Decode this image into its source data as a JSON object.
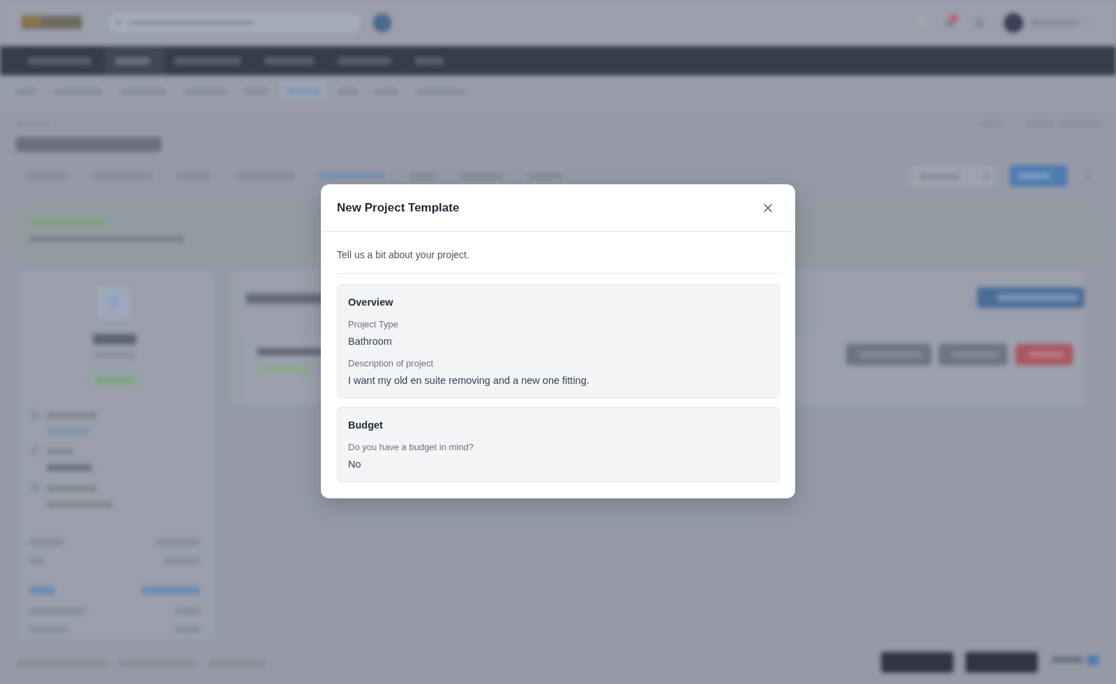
{
  "modal": {
    "title": "New Project Template",
    "intro": "Tell us a bit about your project.",
    "sections": [
      {
        "title": "Overview",
        "fields": [
          {
            "label": "Project Type",
            "value": "Bathroom"
          },
          {
            "label": "Description of project",
            "value": "I want my old en suite removing and a new one fitting."
          }
        ]
      },
      {
        "title": "Budget",
        "fields": [
          {
            "label": "Do you have a budget in mind?",
            "value": "No"
          }
        ]
      }
    ]
  }
}
